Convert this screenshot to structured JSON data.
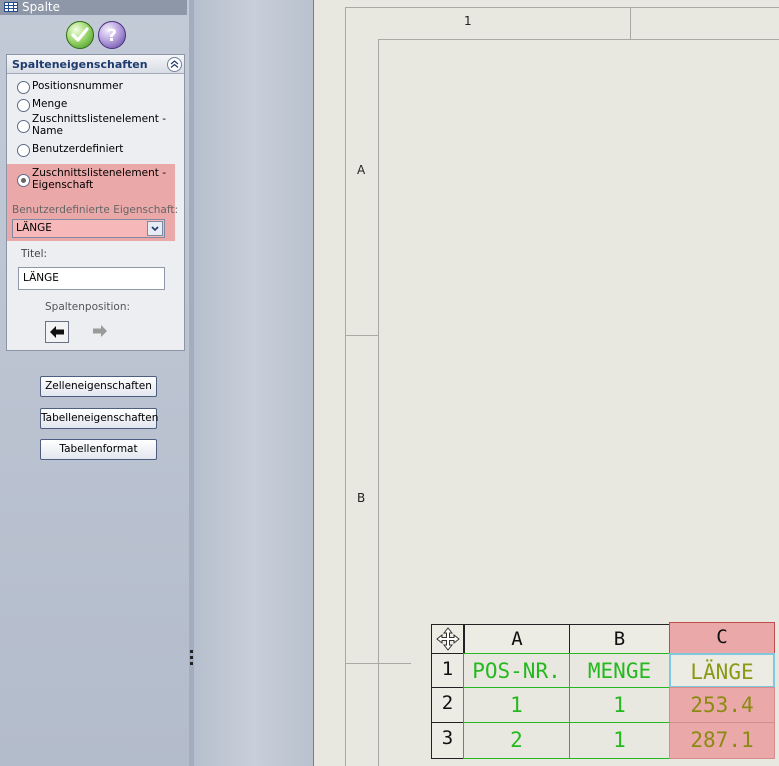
{
  "panel": {
    "title": "Spalte",
    "title_icon": "table-icon",
    "ok_icon": "checkmark-icon",
    "help_icon": "question-icon",
    "group_title": "Spalteneigenschaften",
    "radios": [
      {
        "label": "Positionsnummer",
        "selected": false
      },
      {
        "label": "Menge",
        "selected": false
      },
      {
        "label": "Zuschnittslistenelement -\nName",
        "selected": false
      },
      {
        "label": "Benutzerdefiniert",
        "selected": false
      },
      {
        "label": "Zuschnittslistenelement -\nEigenschaft",
        "selected": true
      }
    ],
    "custom_prop_label": "Benutzerdefinierte Eigenschaft:",
    "custom_prop_value": "LÄNGE",
    "title_label": "Titel:",
    "title_value": "LÄNGE",
    "column_pos_label": "Spaltenposition:",
    "buttons": {
      "cell_props": "Zelleneigenschaften",
      "table_props": "Tabelleneigenschaften",
      "table_format": "Tabellenformat"
    },
    "highlight_color": "#eba8a8"
  },
  "sheet": {
    "zone_col": "1",
    "zone_rows": [
      "A",
      "B"
    ]
  },
  "table": {
    "move_icon": "move-arrows-icon",
    "col_headers": [
      "A",
      "B",
      "C"
    ],
    "row_headers": [
      "1",
      "2",
      "3"
    ],
    "rows": [
      [
        "POS-NR.",
        "MENGE",
        "LÄNGE"
      ],
      [
        "1",
        "1",
        "253.4"
      ],
      [
        "2",
        "1",
        "287.1"
      ]
    ],
    "text_color": "#25b91f",
    "selected_column_color": "#eba8a8"
  }
}
